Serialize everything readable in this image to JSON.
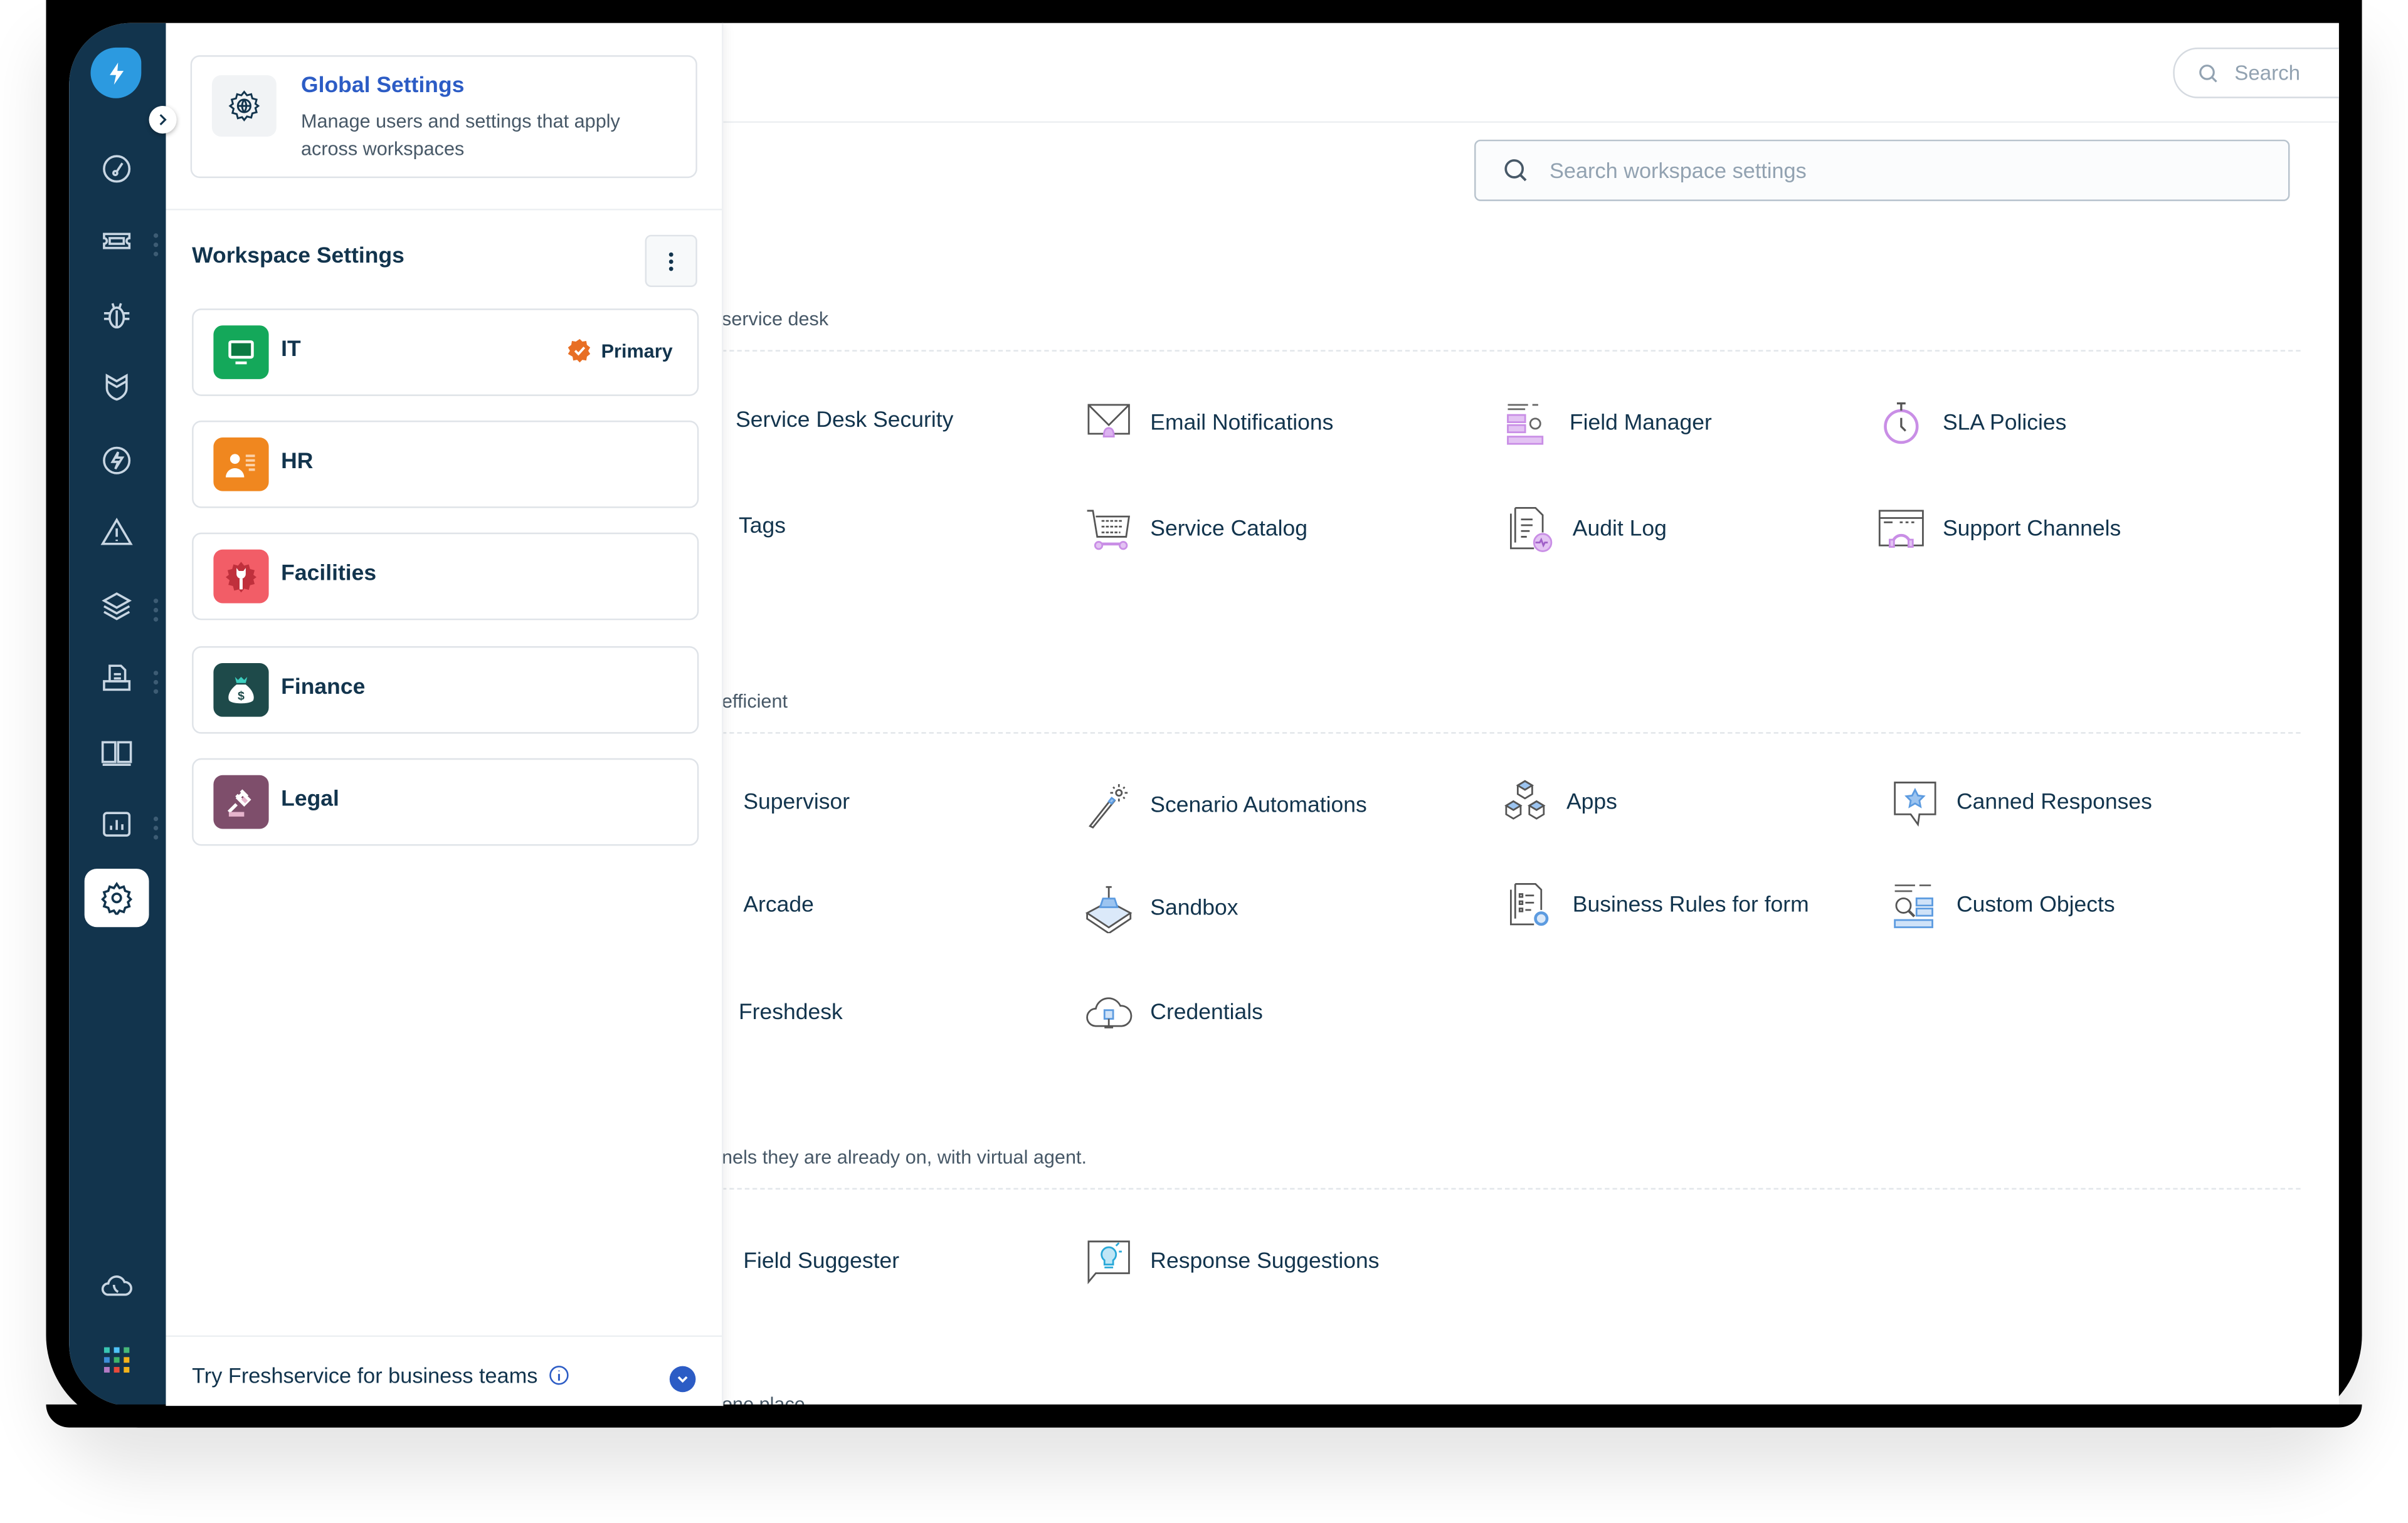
{
  "header": {
    "search_placeholder": "Search",
    "icons": [
      "add-icon",
      "todo-list-icon",
      "calendar-icon",
      "help-icon",
      "bell-icon",
      "avatar"
    ]
  },
  "nav": {
    "items": [
      "dashboard-icon",
      "tickets-icon",
      "problems-icon",
      "changes-icon",
      "releases-icon",
      "alerts-icon",
      "assets-icon",
      "service-catalog-icon",
      "solutions-icon",
      "analytics-icon",
      "admin-settings-icon"
    ],
    "bottom": [
      "cloud-phone-icon",
      "apps-grid-icon"
    ],
    "active": "admin-settings-icon"
  },
  "panel": {
    "global": {
      "title": "Global Settings",
      "description": "Manage users and settings that apply across workspaces"
    },
    "workspace_heading": "Workspace Settings",
    "workspaces": [
      {
        "name": "IT",
        "color": "#14a85a",
        "badge": "Primary"
      },
      {
        "name": "HR",
        "color": "#f0871f"
      },
      {
        "name": "Facilities",
        "color": "#f25d67"
      },
      {
        "name": "Finance",
        "color": "#1e4a4a"
      },
      {
        "name": "Legal",
        "color": "#7e4e6b"
      }
    ],
    "footer": "Try Freshservice for business teams"
  },
  "main": {
    "search_placeholder": "Search workspace settings",
    "sections": [
      {
        "description": "service desk",
        "items": [
          "Service Desk Security",
          "Email Notifications",
          "Field Manager",
          "SLA Policies",
          "Tags",
          "Service Catalog",
          "Audit Log",
          "Support Channels"
        ]
      },
      {
        "description": "efficient",
        "items": [
          "Supervisor",
          "Scenario Automations",
          "Apps",
          "Canned Responses",
          "Arcade",
          "Sandbox",
          "Business Rules for form",
          "Custom Objects",
          "Freshdesk",
          "Credentials"
        ]
      },
      {
        "description": "nels they are already on, with virtual agent.",
        "items": [
          "Field Suggester",
          "Response Suggestions"
        ]
      },
      {
        "description": "one place"
      }
    ]
  },
  "colors": {
    "nav_bg": "#12344d",
    "accent_blue": "#2c5cc5",
    "primary_badge": "#e86f25",
    "section1_icon": "#c98ee6",
    "section2_icon": "#7fb3ec",
    "section3_icon": "#28a8d8"
  }
}
